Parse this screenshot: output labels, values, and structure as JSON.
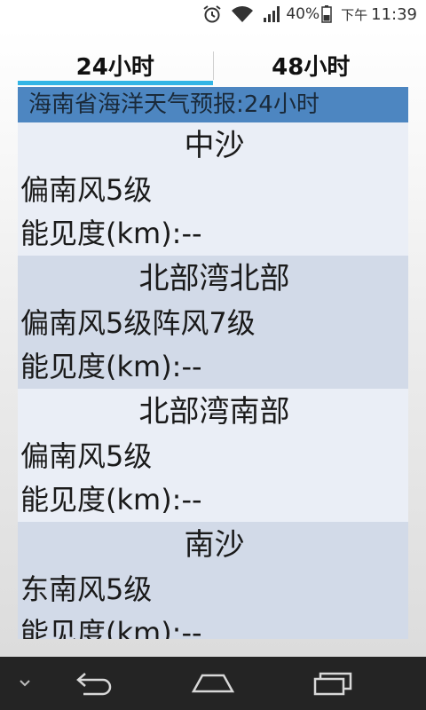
{
  "status_bar": {
    "icons": [
      "alarm-icon",
      "wifi-icon",
      "signal-icon",
      "battery-icon"
    ],
    "battery": "40%",
    "ampm": "下午",
    "time": "11:39"
  },
  "tabs": [
    {
      "label": "24小时",
      "active": true
    },
    {
      "label": "48小时",
      "active": false
    }
  ],
  "accent_color": "#33b5e5",
  "header": {
    "title": "海南省海洋天气预报:24小时"
  },
  "regions": [
    {
      "name": "中沙",
      "wind": "偏南风5级",
      "visibility": "能见度(km):--"
    },
    {
      "name": "北部湾北部",
      "wind": "偏南风5级阵风7级",
      "visibility": "能见度(km):--"
    },
    {
      "name": "北部湾南部",
      "wind": "偏南风5级",
      "visibility": "能见度(km):--"
    },
    {
      "name": "南沙",
      "wind": "东南风5级",
      "visibility": "能见度(km):--"
    }
  ],
  "nav_bar": {
    "icons": [
      "chevron-down-icon",
      "back-icon",
      "home-icon",
      "recent-apps-icon"
    ]
  }
}
